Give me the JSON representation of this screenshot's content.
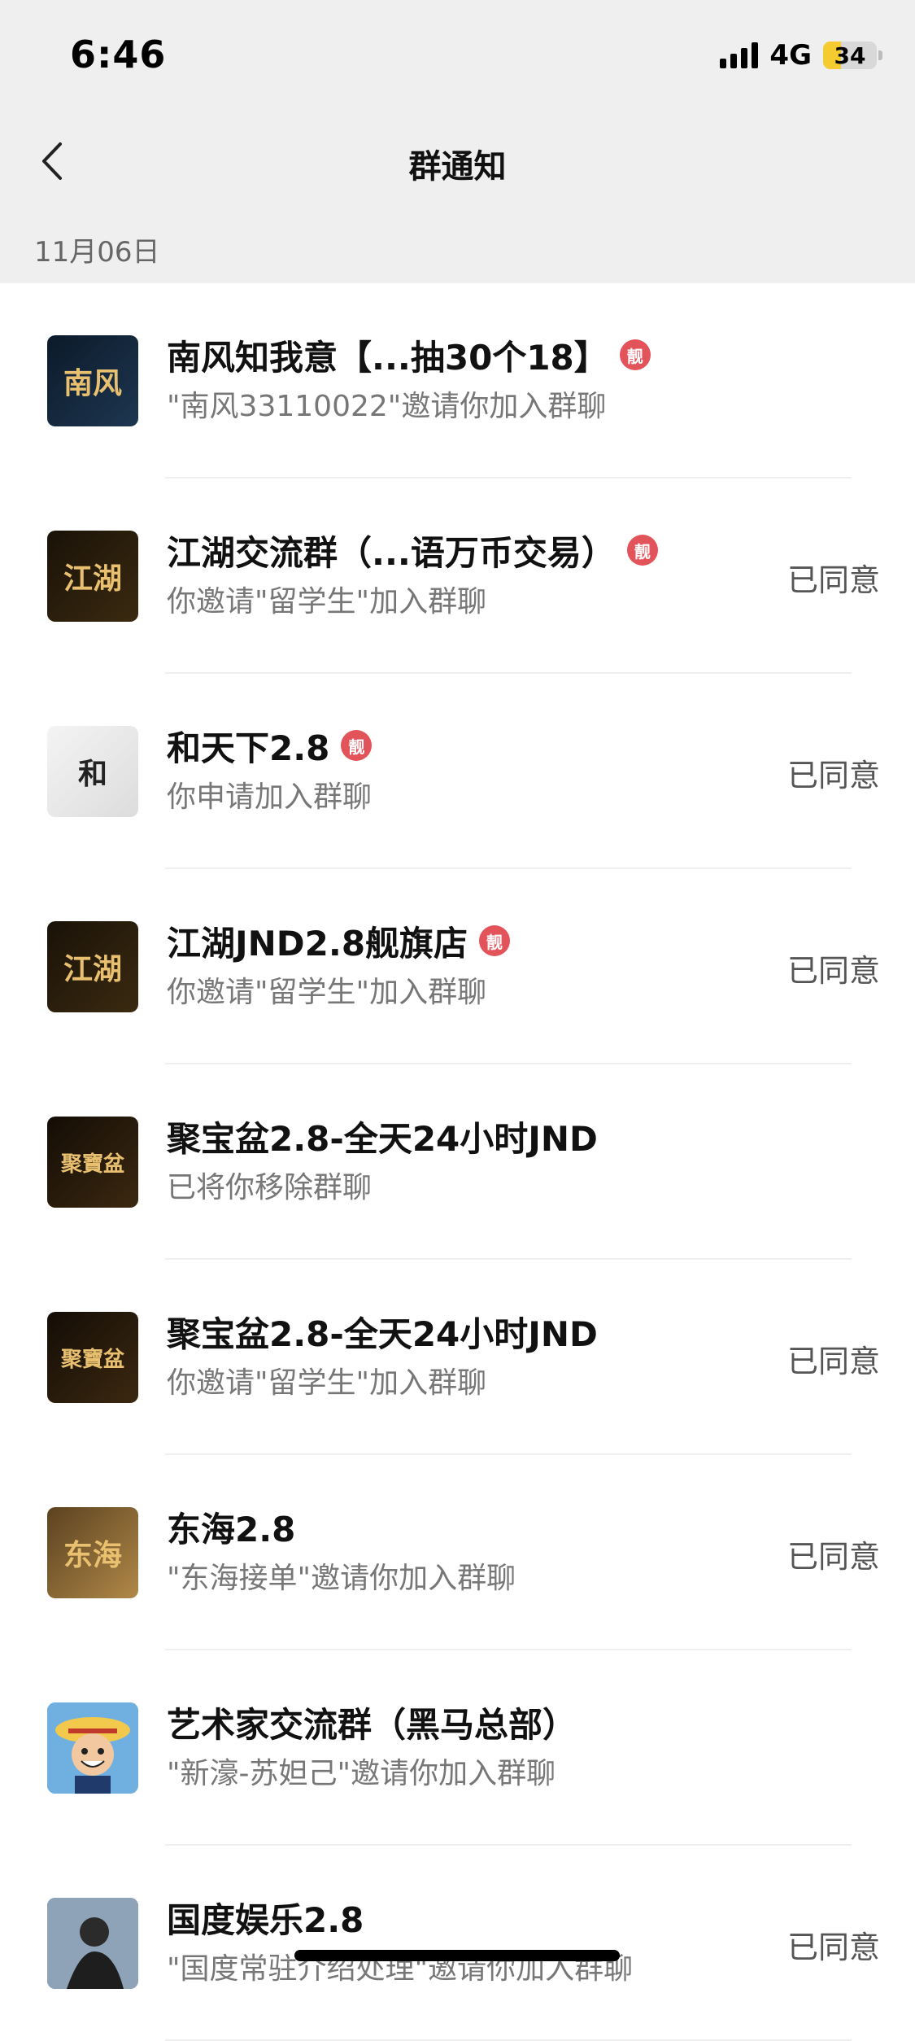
{
  "status_bar": {
    "time": "6:46",
    "network": "4G",
    "battery": "34",
    "battery_fraction": 0.34
  },
  "nav": {
    "title": "群通知",
    "back_icon": "chevron-left-icon"
  },
  "date_header": "11月06日",
  "badge_text": "靓",
  "items": [
    {
      "name": "南风知我意【...抽30个18】",
      "sub": "\"南风33110022\"邀请你加入群聊",
      "status": "",
      "badge": true,
      "avatar_text": "南风",
      "avatar_colors": [
        "#0c1a2a",
        "#1d3650"
      ]
    },
    {
      "name": "江湖交流群（...语万币交易）",
      "sub": "你邀请\"留学生\"加入群聊",
      "status": "已同意",
      "badge": true,
      "avatar_text": "江湖",
      "avatar_colors": [
        "#1a1208",
        "#3a2a10"
      ]
    },
    {
      "name": "和天下2.8",
      "sub": "你申请加入群聊",
      "status": "已同意",
      "badge": true,
      "avatar_text": "和",
      "avatar_colors": [
        "#f4f4f4",
        "#dcdcdc"
      ]
    },
    {
      "name": "江湖JND2.8舰旗店",
      "sub": "你邀请\"留学生\"加入群聊",
      "status": "已同意",
      "badge": true,
      "avatar_text": "江湖",
      "avatar_colors": [
        "#1a1208",
        "#3a2a10"
      ]
    },
    {
      "name": "聚宝盆2.8-全天24小时JND",
      "sub": "已将你移除群聊",
      "status": "",
      "badge": false,
      "avatar_text": "聚寶盆",
      "avatar_colors": [
        "#140d06",
        "#3b2810"
      ]
    },
    {
      "name": "聚宝盆2.8-全天24小时JND",
      "sub": "你邀请\"留学生\"加入群聊",
      "status": "已同意",
      "badge": false,
      "avatar_text": "聚寶盆",
      "avatar_colors": [
        "#140d06",
        "#3b2810"
      ]
    },
    {
      "name": "东海2.8",
      "sub": "\"东海接单\"邀请你加入群聊",
      "status": "已同意",
      "badge": false,
      "avatar_text": "东海",
      "avatar_colors": [
        "#5b4220",
        "#b08848"
      ]
    },
    {
      "name": "艺术家交流群（黑马总部）",
      "sub": "\"新濠-苏妲己\"邀请你加入群聊",
      "status": "",
      "badge": false,
      "avatar_text": "",
      "avatar_colors": [
        "#5aa0d8",
        "#f2c94c"
      ]
    },
    {
      "name": "国度娱乐2.8",
      "sub": "\"国度常驻介绍处理\"邀请你加入群聊",
      "status": "已同意",
      "badge": false,
      "avatar_text": "",
      "avatar_colors": [
        "#3a4a5c",
        "#a9b7c6"
      ]
    }
  ]
}
